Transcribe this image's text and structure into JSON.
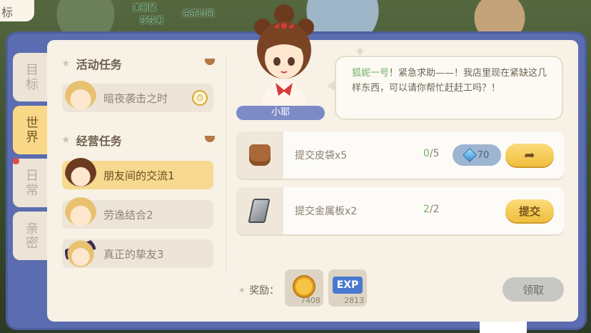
{
  "corner_tab": "标",
  "world": {
    "labels": [
      "美丽鼠",
      "莎莎男",
      "杀杀时间"
    ]
  },
  "side_tabs": [
    {
      "label": "目标",
      "active": false
    },
    {
      "label": "世界",
      "active": true
    },
    {
      "label": "日常",
      "active": false,
      "has_dot": true
    },
    {
      "label": "亲密",
      "active": false
    }
  ],
  "sections": {
    "activity": {
      "title": "活动任务",
      "items": [
        {
          "label": "暗夜袭击之时",
          "icon": "clock-icon"
        }
      ]
    },
    "business": {
      "title": "经营任务",
      "items": [
        {
          "label": "朋友间的交流1",
          "active": true
        },
        {
          "label": "劳逸结合2",
          "active": false
        },
        {
          "label": "真正的挚友3",
          "active": false
        }
      ]
    }
  },
  "npc": {
    "name": "小耶"
  },
  "dialogue": {
    "speaker": "狐妮一号",
    "text": "！紧急求助——！我店里现在紧缺这几样东西，可以请你帮忙赶赶工吗？！"
  },
  "quests": [
    {
      "label": "提交皮袋x5",
      "count_have": "0",
      "count_sep": "/5",
      "gem_cost": "70",
      "action": "arrow-icon"
    },
    {
      "label": "提交金属板x2",
      "count_have": "2",
      "count_sep": "/2",
      "action_label": "提交"
    }
  ],
  "reward": {
    "label": "奖励：",
    "items": [
      {
        "icon": "coin-icon",
        "amount": "7408"
      },
      {
        "icon": "exp-icon",
        "icon_text": "EXP",
        "amount": "2813"
      }
    ],
    "claim_label": "领取"
  },
  "colors": {
    "frame": "#5b6db0",
    "panel": "#f7f1e6",
    "active_tab": "#f9d987",
    "accent_yellow": "#f0bf3c",
    "green_text": "#71b564"
  }
}
